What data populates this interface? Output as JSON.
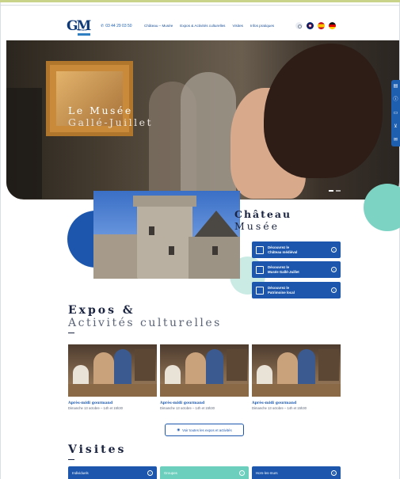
{
  "header": {
    "logo_text": "GM",
    "logo_sub": "Jetsite",
    "phone": "03 44 29 03 50",
    "nav": [
      "Château – Musée",
      "Expos & Activités culturelles",
      "Visites",
      "Infos pratiques"
    ],
    "languages": [
      "English",
      "Español",
      "Deutsch"
    ]
  },
  "hero": {
    "title_line1": "Le Musée",
    "title_line2": "Gallé-Juillet",
    "slides": 2,
    "active_slide": 1
  },
  "side_tools": [
    "calendar-icon",
    "info-icon",
    "ticket-icon",
    "cart-icon",
    "mail-icon"
  ],
  "chateau": {
    "title_line1": "Château",
    "title_line2": "Musée",
    "buttons": [
      {
        "label": "Découvrez le Château médiéval",
        "line1": "Découvrez le",
        "line2": "Château médiéval",
        "icon": "castle-icon"
      },
      {
        "label": "Découvrez le Musée Gallé-Juillet",
        "line1": "Découvrez le",
        "line2": "Musée Gallé-Juillet",
        "icon": "vase-icon"
      },
      {
        "label": "Découvrez le Patrimoine local",
        "line1": "Découvrez le",
        "line2": "Patrimoine local",
        "icon": "heritage-icon"
      }
    ]
  },
  "expos": {
    "title_line1": "Expos &",
    "title_line2": "Activités culturelles",
    "cards": [
      {
        "title": "Après-midi gourmand",
        "date": "Dimanche 13 octobre – 14h et 15h30"
      },
      {
        "title": "Après-midi gourmand",
        "date": "Dimanche 13 octobre – 14h et 15h30"
      },
      {
        "title": "Après-midi gourmand",
        "date": "Dimanche 13 octobre – 14h et 15h30"
      }
    ],
    "all_button": "Voir toutes les expos et activités"
  },
  "visites": {
    "title": "Visites",
    "buttons": [
      {
        "label": "Individuels",
        "color": "#1c57ad"
      },
      {
        "label": "Groupes",
        "color": "#6ccfbd"
      },
      {
        "label": "Hors-les-murs",
        "color": "#1c57ad"
      }
    ]
  },
  "colors": {
    "primary": "#1c57ad",
    "accent": "#7cd3c4",
    "text": "#1b2440"
  }
}
